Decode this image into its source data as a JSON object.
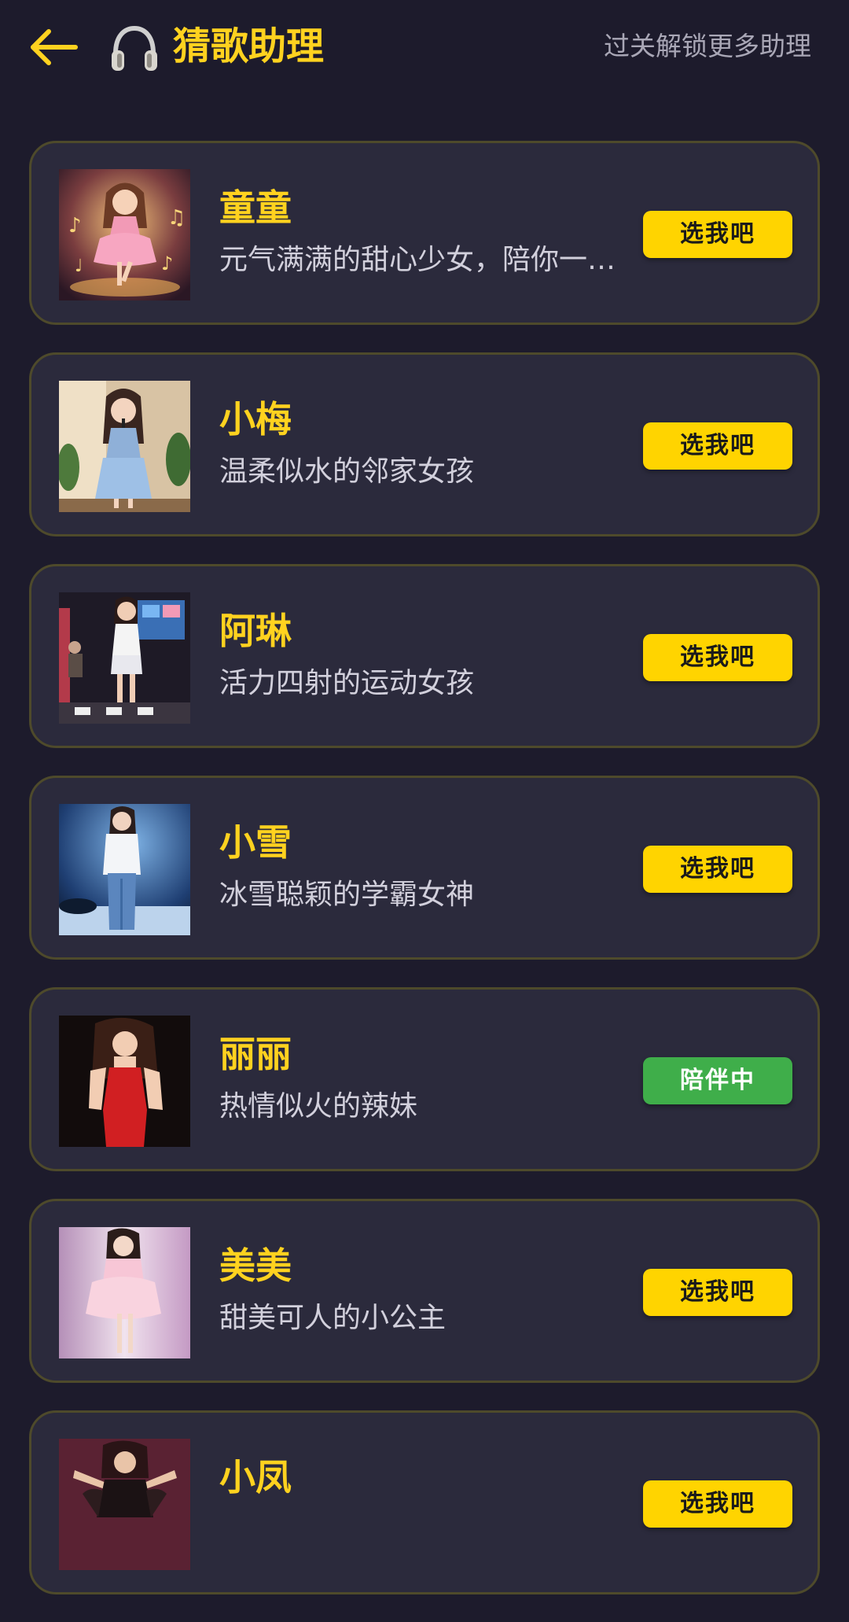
{
  "header": {
    "title": "猜歌助理",
    "unlock_link": "过关解锁更多助理"
  },
  "colors": {
    "accent": "#ffd21f",
    "background": "#1d1b2c",
    "card": "#2b2a3c",
    "card_border": "#4e4a2b",
    "button_active": "#3fae4a"
  },
  "assistants": [
    {
      "name": "童童",
      "desc": "元气满满的甜心少女，陪你一起快乐猜歌",
      "button": "选我吧",
      "active": false,
      "avatar": "girl-in-pink-dress-with-music-notes-image"
    },
    {
      "name": "小梅",
      "desc": "温柔似水的邻家女孩",
      "button": "选我吧",
      "active": false,
      "avatar": "girl-singing-in-blue-dress-image"
    },
    {
      "name": "阿琳",
      "desc": "活力四射的运动女孩",
      "button": "选我吧",
      "active": false,
      "avatar": "girl-singing-on-stage-image"
    },
    {
      "name": "小雪",
      "desc": "冰雪聪颖的学霸女神",
      "button": "选我吧",
      "active": false,
      "avatar": "girl-singing-in-concert-image"
    },
    {
      "name": "丽丽",
      "desc": "热情似火的辣妹",
      "button": "陪伴中",
      "active": true,
      "avatar": "woman-in-red-dress-image"
    },
    {
      "name": "美美",
      "desc": "甜美可人的小公主",
      "button": "选我吧",
      "active": false,
      "avatar": "girl-in-pink-gown-image"
    },
    {
      "name": "小凤",
      "desc": "",
      "button": "选我吧",
      "active": false,
      "avatar": "dancer-with-feathers-image"
    }
  ]
}
